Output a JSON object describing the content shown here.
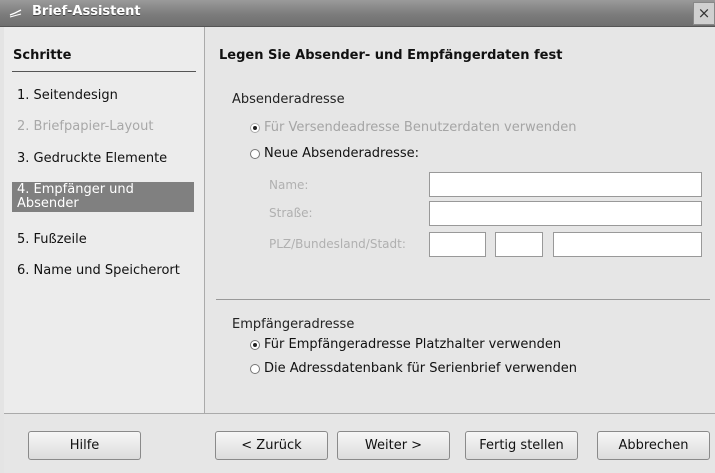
{
  "window": {
    "title": "Brief-Assistent",
    "close_glyph": "×"
  },
  "steps": {
    "heading": "Schritte",
    "items": [
      {
        "label": "1. Seitendesign",
        "state": "normal"
      },
      {
        "label": "2. Briefpapier-Layout",
        "state": "disabled"
      },
      {
        "label": "3. Gedruckte Elemente",
        "state": "normal"
      },
      {
        "label": "4. Empfänger und Absender",
        "state": "active"
      },
      {
        "label": "5. Fußzeile",
        "state": "normal"
      },
      {
        "label": "6. Name und Speicherort",
        "state": "normal"
      }
    ]
  },
  "main": {
    "heading": "Legen Sie Absender- und Empfängerdaten fest",
    "sender": {
      "label": "Absenderadresse",
      "option_user_data": "Für Versendeadresse Benutzerdaten verwenden",
      "option_new_address": "Neue Absenderadresse:",
      "name_label": "Name:",
      "street_label": "Straße:",
      "zip_label": "PLZ/Bundesland/Stadt:"
    },
    "recipient": {
      "label": "Empfängeradresse",
      "option_placeholder": "Für Empfängeradresse Platzhalter verwenden",
      "option_database": "Die Adressdatenbank für Serienbrief verwenden"
    }
  },
  "buttons": {
    "help": "Hilfe",
    "back": "< Zurück",
    "next": "Weiter >",
    "finish": "Fertig stellen",
    "cancel": "Abbrechen"
  }
}
